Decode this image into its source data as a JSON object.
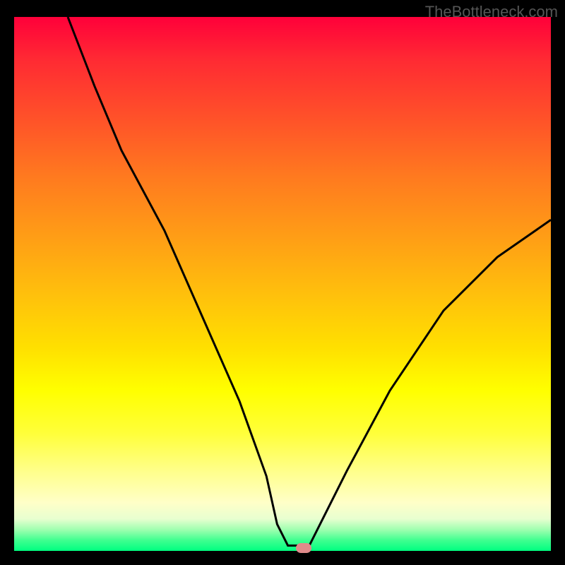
{
  "watermark": "TheBottleneck.com",
  "chart_data": {
    "type": "line",
    "title": "",
    "xlabel": "",
    "ylabel": "",
    "xlim": [
      0,
      100
    ],
    "ylim": [
      0,
      100
    ],
    "background_gradient": {
      "top": "#ff003a",
      "middle": "#ffff00",
      "bottom": "#00ff80"
    },
    "series": [
      {
        "name": "curve",
        "x": [
          10,
          15,
          20,
          28,
          35,
          42,
          47,
          49,
          51,
          54,
          55,
          57,
          62,
          70,
          80,
          90,
          100
        ],
        "values": [
          100,
          87,
          75,
          60,
          44,
          28,
          14,
          5,
          1,
          1,
          1,
          5,
          15,
          30,
          45,
          55,
          62
        ]
      }
    ],
    "marker": {
      "x": 54,
      "y": 0.5,
      "color": "#e08a8a"
    }
  }
}
